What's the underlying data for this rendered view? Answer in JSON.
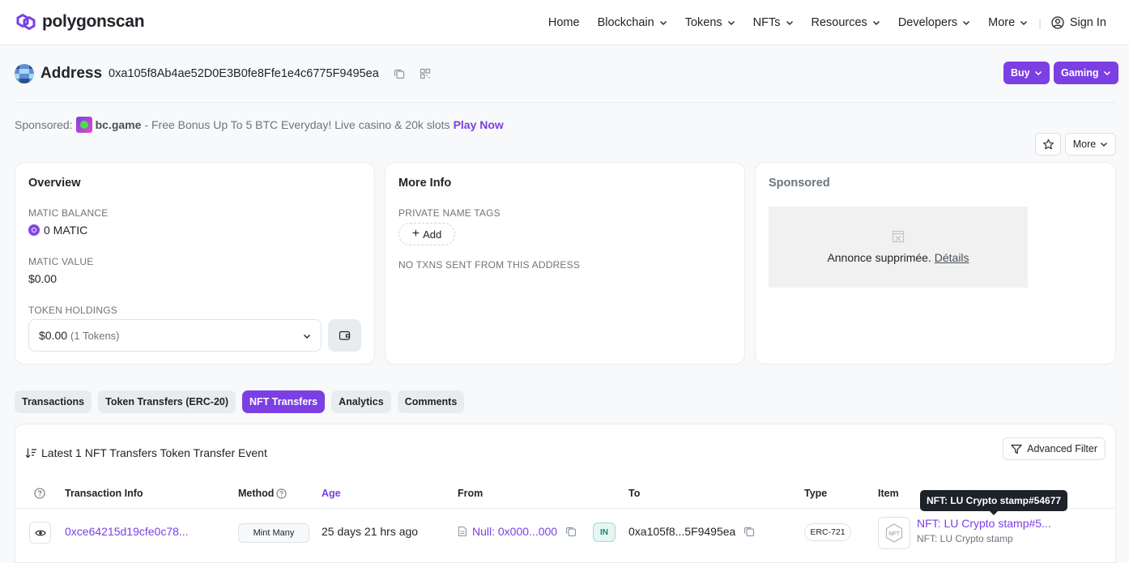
{
  "header": {
    "logo_text": "polygonscan",
    "nav": [
      {
        "label": "Home",
        "dropdown": false
      },
      {
        "label": "Blockchain",
        "dropdown": true
      },
      {
        "label": "Tokens",
        "dropdown": true
      },
      {
        "label": "NFTs",
        "dropdown": true
      },
      {
        "label": "Resources",
        "dropdown": true
      },
      {
        "label": "Developers",
        "dropdown": true
      },
      {
        "label": "More",
        "dropdown": true
      }
    ],
    "signin_label": "Sign In"
  },
  "address": {
    "label": "Address",
    "hash": "0xa105f8Ab4ae52D0E3B0fe8Ffe1e4c6775F9495ea",
    "buy_label": "Buy",
    "gaming_label": "Gaming"
  },
  "sponsored": {
    "prefix": "Sponsored:",
    "name": "bc.game",
    "text": "- Free Bonus Up To 5 BTC Everyday! Live casino & 20k slots",
    "cta": "Play Now"
  },
  "actions": {
    "more_label": "More"
  },
  "overview": {
    "title": "Overview",
    "balance_label": "MATIC BALANCE",
    "balance_value": "0 MATIC",
    "value_label": "MATIC VALUE",
    "value_value": "$0.00",
    "holdings_label": "TOKEN HOLDINGS",
    "holdings_value": "$0.00",
    "holdings_count": "(1 Tokens)"
  },
  "more_info": {
    "title": "More Info",
    "tags_label": "PRIVATE NAME TAGS",
    "add_label": "Add",
    "no_txns": "NO TXNS SENT FROM THIS ADDRESS"
  },
  "sponsored_card": {
    "title": "Sponsored",
    "ad_text": "Annonce supprimée.",
    "ad_link": "Détails"
  },
  "tabs": [
    {
      "label": "Transactions",
      "active": false
    },
    {
      "label": "Token Transfers (ERC-20)",
      "active": false
    },
    {
      "label": "NFT Transfers",
      "active": true
    },
    {
      "label": "Analytics",
      "active": false
    },
    {
      "label": "Comments",
      "active": false
    }
  ],
  "table": {
    "caption": "Latest 1 NFT Transfers Token Transfer Event",
    "advanced_filter": "Advanced Filter",
    "headers": {
      "txn_info": "Transaction Info",
      "method": "Method",
      "age": "Age",
      "from": "From",
      "to": "To",
      "type": "Type",
      "item": "Item"
    },
    "rows": [
      {
        "txn_hash": "0xce64215d19cfe0c78...",
        "method": "Mint Many",
        "age": "25 days 21 hrs ago",
        "from": "Null: 0x000...000",
        "direction": "IN",
        "to": "0xa105f8...5F9495ea",
        "type": "ERC-721",
        "item_name": "NFT: LU Crypto stamp#5...",
        "item_collection": "NFT: LU Crypto stamp"
      }
    ]
  },
  "tooltip": "NFT: LU Crypto stamp#54677",
  "colors": {
    "accent": "#7b3fe4",
    "in_badge": "#0a8a6a"
  }
}
